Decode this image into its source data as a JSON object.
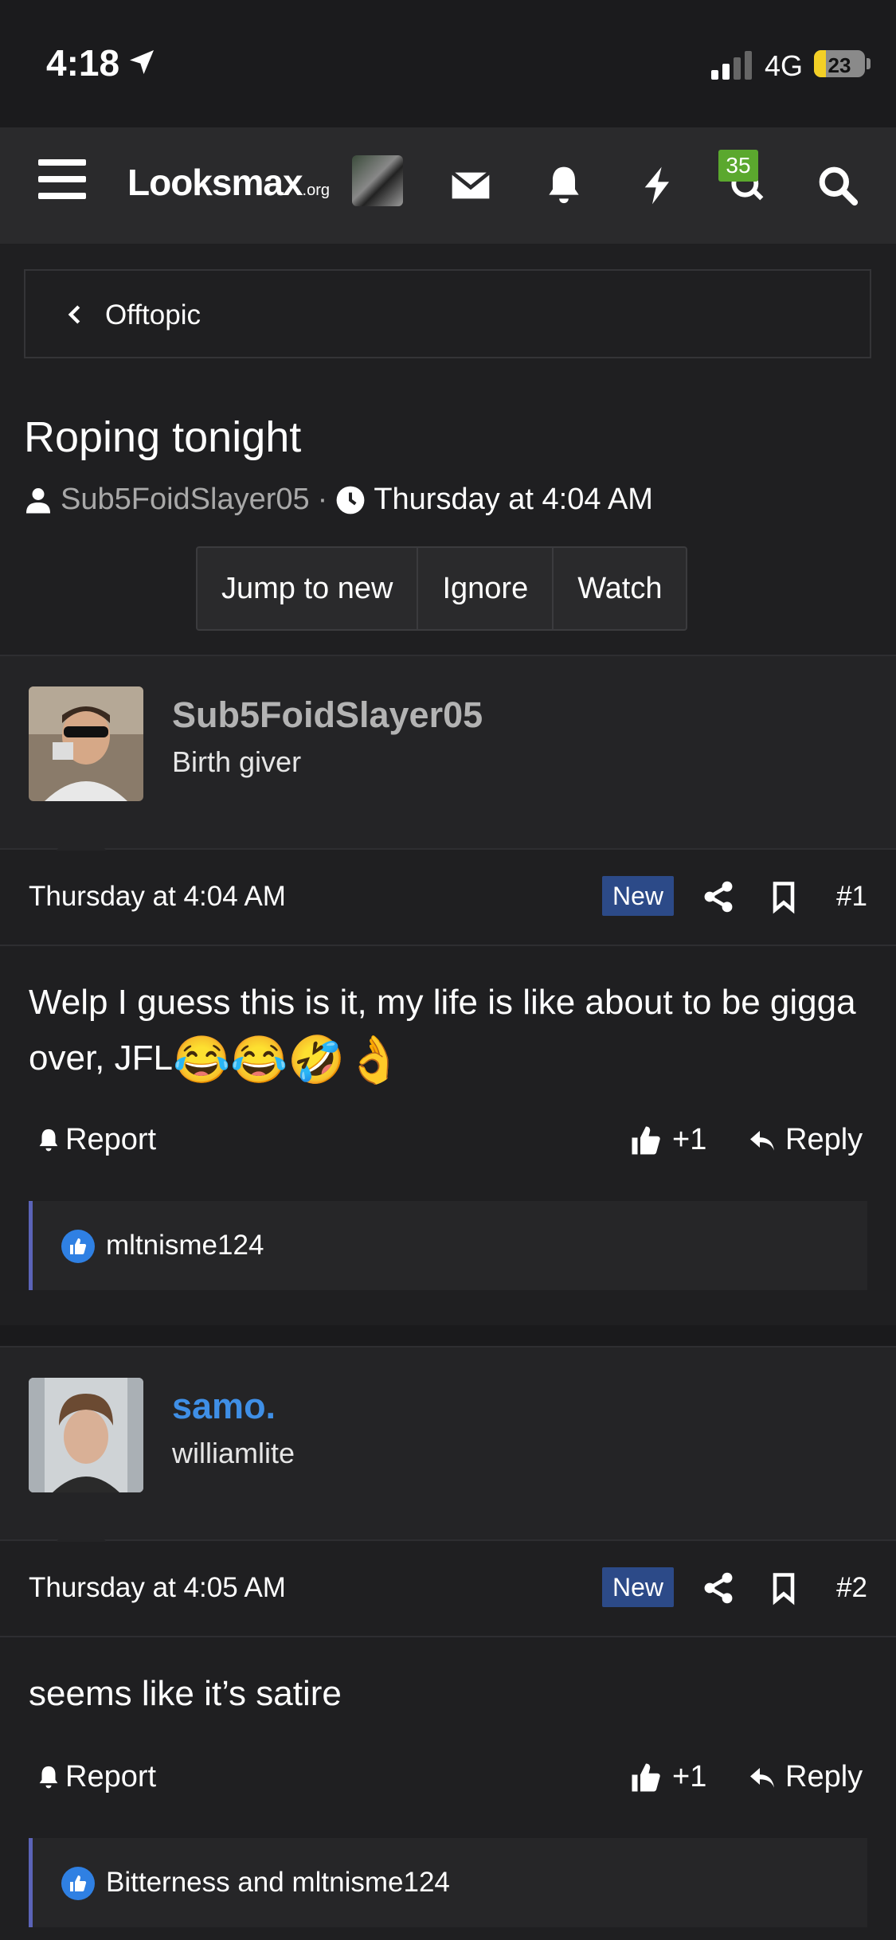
{
  "status_bar": {
    "time": "4:18",
    "network": "4G",
    "battery": "23",
    "battery_level": 0.23
  },
  "nav": {
    "logo_main": "Looksmax",
    "logo_suffix": ".org",
    "icons": [
      "menu-icon",
      "avatar",
      "mail-icon",
      "bell-icon",
      "bolt-icon",
      "chat-icon",
      "search-icon"
    ],
    "chat_badge": "35"
  },
  "breadcrumb": {
    "label": "Offtopic"
  },
  "thread": {
    "title": "Roping tonight",
    "author": "Sub5FoidSlayer05",
    "separator": "·",
    "date": "Thursday at 4:04 AM",
    "buttons": {
      "jump": "Jump to new",
      "ignore": "Ignore",
      "watch": "Watch"
    }
  },
  "posts": [
    {
      "username": "Sub5FoidSlayer05",
      "username_color": "#b3b3b3",
      "role": "Birth giver",
      "date": "Thursday at 4:04 AM",
      "new_label": "New",
      "number": "#1",
      "body": "Welp I guess this is it, my life is like about to be gigga over, JFL",
      "emoji": "😂😂🤣👌",
      "report": "Report",
      "likes": "+1",
      "reply": "Reply",
      "liked_by": "mltnisme124"
    },
    {
      "username": "samo.",
      "username_color": "#3f8fe6",
      "role": "williamlite",
      "date": "Thursday at 4:05 AM",
      "new_label": "New",
      "number": "#2",
      "body": "seems like it’s satire",
      "emoji": "",
      "report": "Report",
      "likes": "+1",
      "reply": "Reply",
      "liked_by": "Bitterness and mltnisme124"
    }
  ]
}
